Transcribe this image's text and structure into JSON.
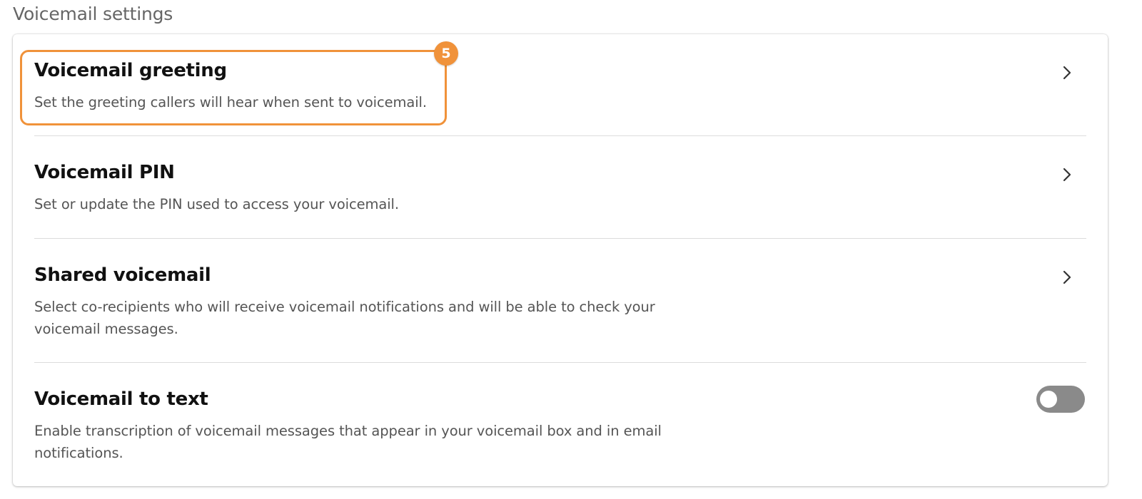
{
  "section": {
    "title": "Voicemail settings"
  },
  "items": [
    {
      "title": "Voicemail greeting",
      "description": "Set the greeting callers will hear when sent to voicemail.",
      "control": "chevron-right-icon"
    },
    {
      "title": "Voicemail PIN",
      "description": "Set or update the PIN used to access your voicemail.",
      "control": "chevron-right-icon"
    },
    {
      "title": "Shared voicemail",
      "description": "Select co-recipients who will receive voicemail notifications and will be able to check your voicemail messages.",
      "control": "chevron-right-icon"
    },
    {
      "title": "Voicemail to text",
      "description": "Enable transcription of voicemail messages that appear in your voicemail box and in email notifications.",
      "control": "toggle",
      "toggle_on": false
    }
  ],
  "annotation": {
    "step_number": "5",
    "color": "#f0923a"
  },
  "colors": {
    "text_primary": "#111111",
    "text_secondary": "#555555",
    "divider": "#dcdcdc",
    "toggle_off": "#8a8a8a"
  }
}
